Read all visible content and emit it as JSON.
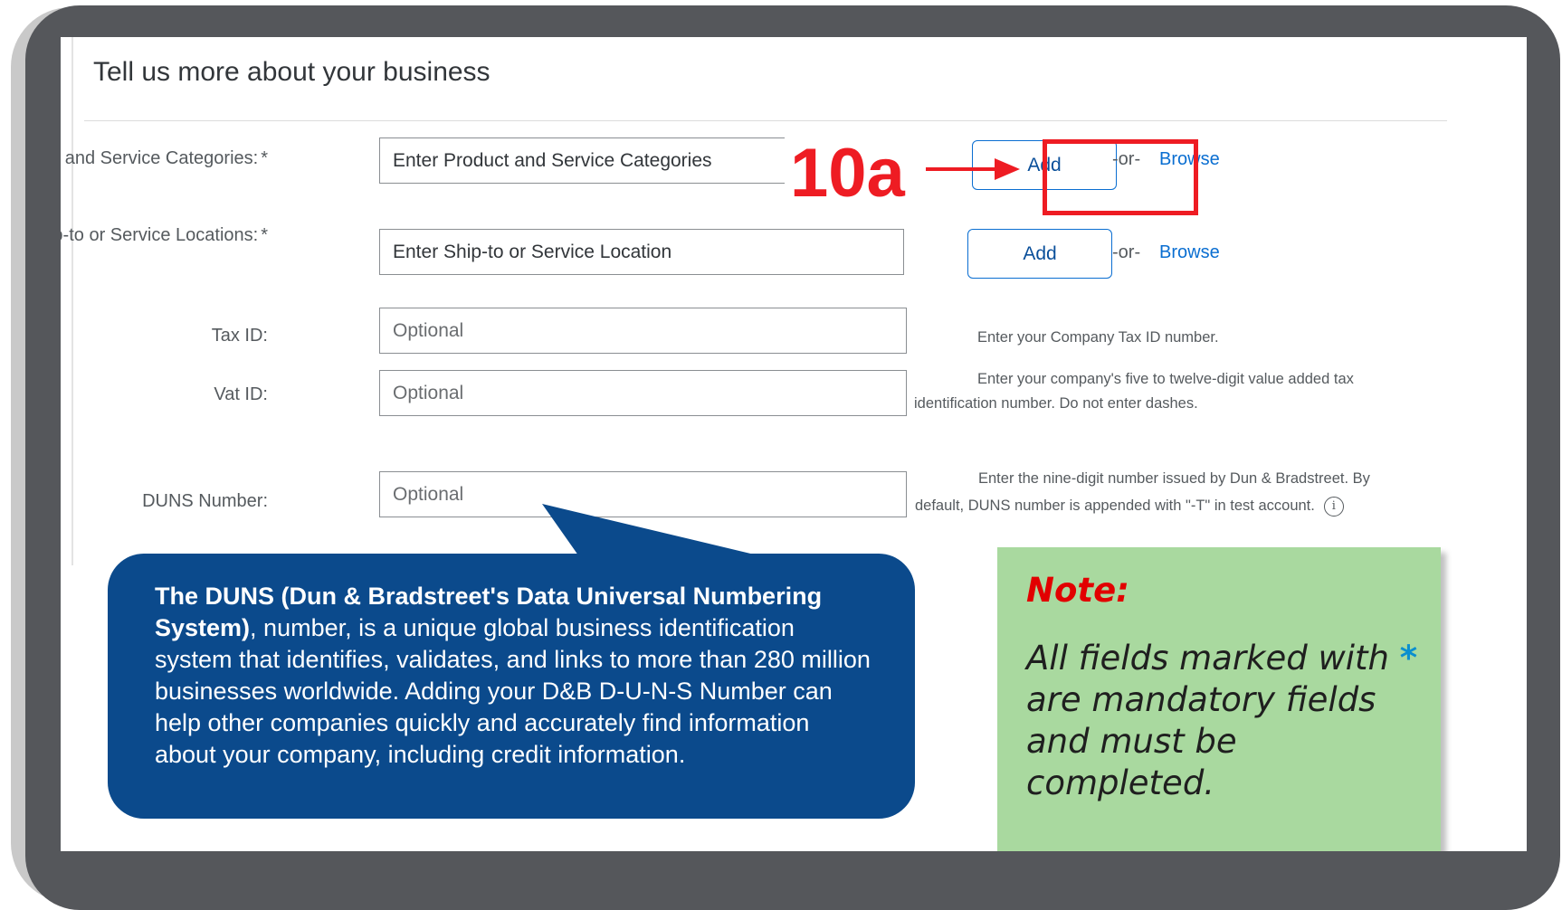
{
  "form": {
    "title": "Tell us more about your business",
    "product_categories": {
      "label": "Product and Service Categories:",
      "required_mark": "*",
      "placeholder": "Enter Product and Service Categories",
      "add_label": "Add",
      "or_label": "-or-",
      "browse_label": "Browse"
    },
    "ship_to": {
      "label": "Ship-to or Service Locations:",
      "required_mark": "*",
      "placeholder": "Enter Ship-to or Service Location",
      "add_label": "Add",
      "or_label": "-or-",
      "browse_label": "Browse"
    },
    "tax_id": {
      "label": "Tax ID:",
      "placeholder": "Optional",
      "help": "Enter your Company Tax ID number."
    },
    "vat_id": {
      "label": "Vat ID:",
      "placeholder": "Optional",
      "help_line1": "Enter your company's five to twelve-digit value added tax",
      "help_line2": "identification number. Do not enter dashes."
    },
    "duns": {
      "label": "DUNS Number:",
      "placeholder": "Optional",
      "help_line1": "Enter the nine-digit number issued by Dun & Bradstreet. By",
      "help_line2": "default, DUNS number is appended with \"-T\" in test account."
    }
  },
  "annotation": {
    "step_label": "10a",
    "highlight_color": "#ee1c23"
  },
  "callout": {
    "bold_text": "The DUNS (Dun & Bradstreet's Data Universal Numbering System)",
    "text": ", number, is a unique global business identification system that identifies, validates, and links to more than 280 million businesses worldwide. Adding your D&B D-U-N-S Number can help other companies quickly and accurately find information about your company, including credit information.",
    "background_color": "#0b4a8c"
  },
  "note": {
    "title": "Note:",
    "text_before_star": "All fields marked with",
    "star": "*",
    "text_after_star": "are mandatory fields and must be completed.",
    "background_color": "#a9d99f"
  },
  "icons": {
    "info": "info-icon",
    "arrow": "right-arrow-icon"
  }
}
